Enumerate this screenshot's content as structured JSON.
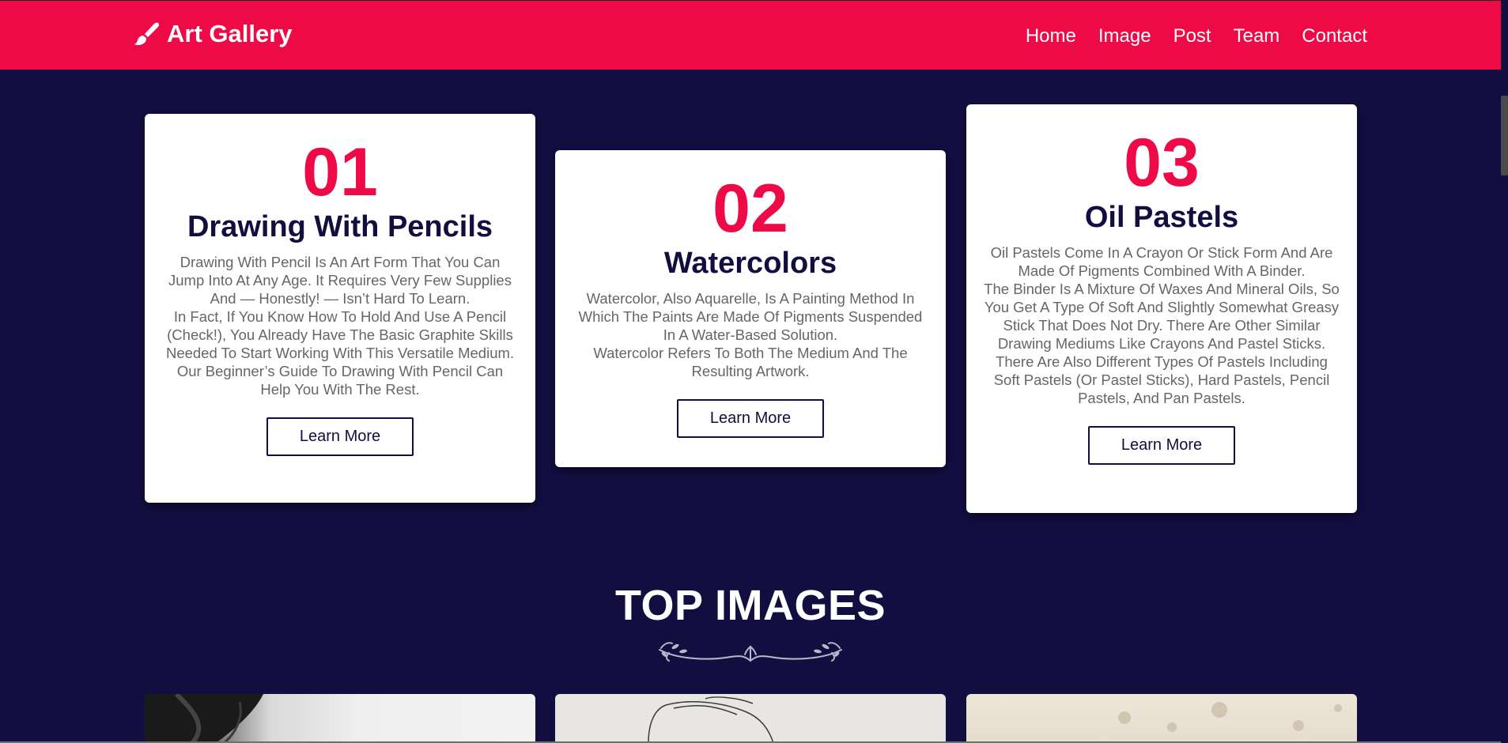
{
  "brand": {
    "name": "Art Gallery",
    "icon": "paint-brush-icon"
  },
  "nav": {
    "items": [
      "Home",
      "Image",
      "Post",
      "Team",
      "Contact"
    ]
  },
  "cards": [
    {
      "number": "01",
      "title": "Drawing With Pencils",
      "paragraphs": [
        "Drawing With Pencil Is An Art Form That You Can Jump Into At Any Age. It Requires Very Few Supplies And — Honestly! — Isn’t Hard To Learn.",
        "In Fact, If You Know How To Hold And Use A Pencil (Check!), You Already Have The Basic Graphite Skills Needed To Start Working With This Versatile Medium.",
        "Our Beginner’s Guide To Drawing With Pencil Can Help You With The Rest."
      ],
      "button": "Learn More"
    },
    {
      "number": "02",
      "title": "Watercolors",
      "paragraphs": [
        "Watercolor, Also Aquarelle, Is A Painting Method In Which The Paints Are Made Of Pigments Suspended In A Water-Based Solution.",
        "Watercolor Refers To Both The Medium And The Resulting Artwork."
      ],
      "button": "Learn More"
    },
    {
      "number": "03",
      "title": "Oil Pastels",
      "paragraphs": [
        "Oil Pastels Come In A Crayon Or Stick Form And Are Made Of Pigments Combined With A Binder.",
        "The Binder Is A Mixture Of Waxes And Mineral Oils, So You Get A Type Of Soft And Slightly Somewhat Greasy Stick That Does Not Dry. There Are Other Similar Drawing Mediums Like Crayons And Pastel Sticks.",
        "There Are Also Different Types Of Pastels Including Soft Pastels (Or Pastel Sticks), Hard Pastels, Pencil Pastels, And Pan Pastels."
      ],
      "button": "Learn More"
    }
  ],
  "top_images": {
    "title": "TOP IMAGES",
    "divider_icon": "floral-divider-icon"
  },
  "colors": {
    "primary": "#ee0a46",
    "background": "#120e40",
    "card": "#ffffff",
    "text_muted": "#666666"
  }
}
